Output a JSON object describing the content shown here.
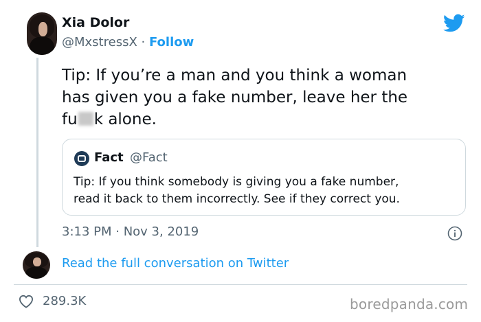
{
  "author": {
    "name": "Xia Dolor",
    "handle": "@MxstressX",
    "separator": " · ",
    "follow_label": "Follow"
  },
  "tweet": {
    "line1": "Tip: If you’re a man and you think a woman",
    "line2": "has given you a fake number, leave her the",
    "line3_before": "fu",
    "line3_after": "k alone."
  },
  "quoted_tweet": {
    "name": "Fact",
    "handle": "@Fact",
    "line1": "Tip: If you think somebody is giving you a fake number,",
    "line2": "read it back to them incorrectly. See if they correct you."
  },
  "timestamp": "3:13 PM · Nov 3, 2019",
  "read_full_label": "Read the full conversation on Twitter",
  "likes_count": "289.3K",
  "watermark": "boredpanda.com",
  "colors": {
    "accent": "#1d9bf0",
    "muted": "#536471",
    "text": "#0f1419",
    "border": "#cfd9de"
  },
  "icons": [
    "twitter-bird-icon",
    "info-icon",
    "heart-icon",
    "fact-logo-icon"
  ]
}
